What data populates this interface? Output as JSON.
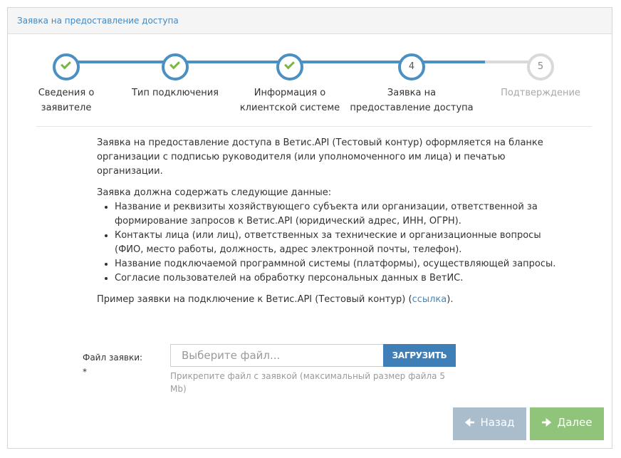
{
  "header": {
    "title": "Заявка на предоставление доступа"
  },
  "wizard": {
    "steps": [
      {
        "line1": "Сведения о",
        "line2": "заявителе",
        "state": "done",
        "num": ""
      },
      {
        "line1": "Тип подключения",
        "line2": "",
        "state": "done",
        "num": ""
      },
      {
        "line1": "Информация о",
        "line2": "клиентской системе",
        "state": "done",
        "num": ""
      },
      {
        "line1": "Заявка на",
        "line2": "предоставление доступа",
        "state": "current",
        "num": "4"
      },
      {
        "line1": "Подтверждение",
        "line2": "",
        "state": "todo",
        "num": "5"
      }
    ]
  },
  "content": {
    "intro": "Заявка на предоставление доступа в Ветис.API (Тестовый контур) оформляется на бланке организации с подписью руководителя (или уполномоченного им лица) и печатью организации.",
    "list_title": "Заявка должна содержать следующие данные:",
    "items": [
      "Название и реквизиты хозяйствующего субъекта или организации, ответственной за формирование запросов к Ветис.API (юридический адрес, ИНН, ОГРН).",
      "Контакты лица (или лиц), ответственных за технические и организационные вопросы (ФИО, место работы, должность, адрес электронной почты, телефон).",
      "Название подключаемой программной системы (платформы), осуществляющей запросы.",
      "Согласие пользователей на обработку персональных данных в ВетИС."
    ],
    "example_prefix": "Пример заявки на подключение к Ветис.API (Тестовый контур) (",
    "example_link": "ссылка",
    "example_suffix": ")."
  },
  "file": {
    "label": "Файл заявки:",
    "required_mark": "*",
    "placeholder": "Выберите файл...",
    "upload_label": "ЗАГРУЗИТЬ",
    "hint": "Прикрепите файл с заявкой (максимальный размер файла 5 Mb)"
  },
  "buttons": {
    "back_label": "Назад",
    "next_label": "Далее"
  },
  "colors": {
    "accent": "#4a90c2",
    "check": "#7ab83d",
    "link": "#3f88c5",
    "back": "#a9bdcc",
    "next": "#8fc47a"
  },
  "icons": {
    "step_done": "check-icon",
    "back": "arrow-left-icon",
    "next": "arrow-right-icon"
  }
}
